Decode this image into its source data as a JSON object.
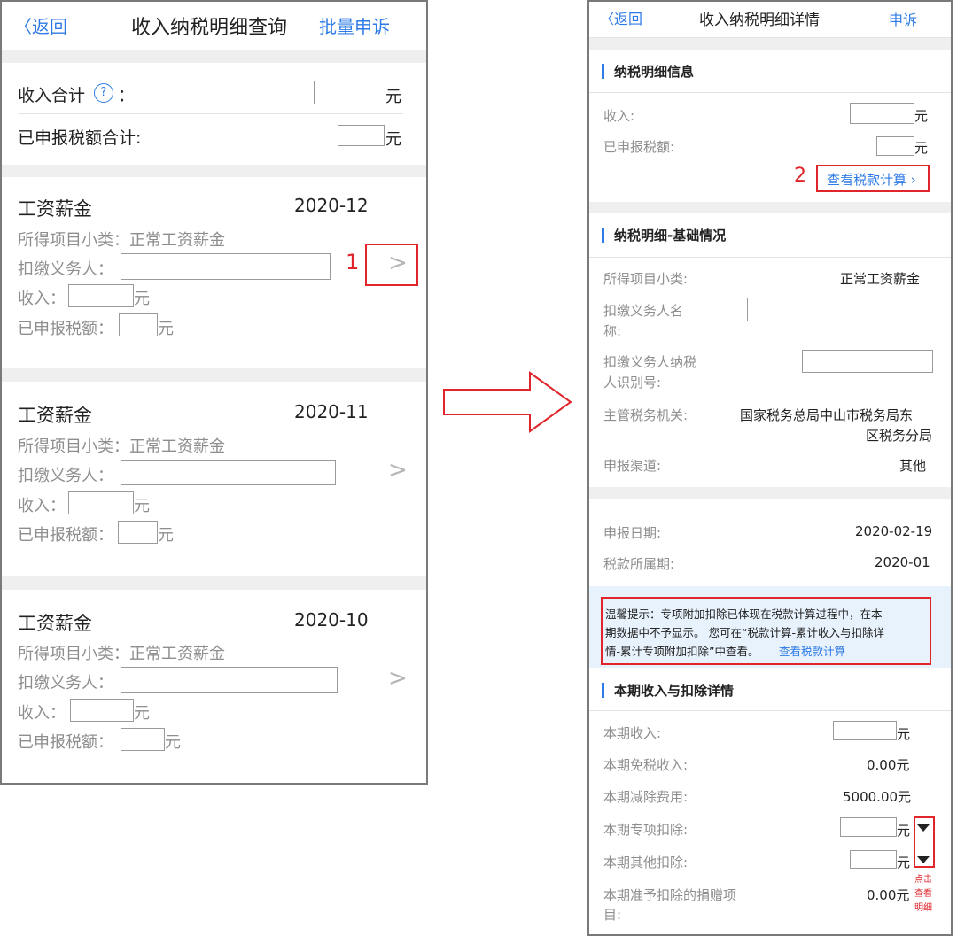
{
  "left": {
    "header": {
      "back": "〈返回",
      "title": "收入纳税明细查询",
      "action": "批量申诉"
    },
    "summary": {
      "income_total_label": "收入合计",
      "help": "?",
      "colon": "：",
      "declared_total_label": "已申报税额合计:",
      "unit": "元"
    },
    "records": [
      {
        "title": "工资薪金",
        "date": "2020-12",
        "subcat": "所得项目小类：正常工资薪金",
        "withholder": "扣缴义务人：",
        "income": "收入：",
        "tax": "已申报税额：",
        "unit": "元"
      },
      {
        "title": "工资薪金",
        "date": "2020-11",
        "subcat": "所得项目小类：正常工资薪金",
        "withholder": "扣缴义务人：",
        "income": "收入：",
        "tax": "已申报税额：",
        "unit": "元"
      },
      {
        "title": "工资薪金",
        "date": "2020-10",
        "subcat": "所得项目小类：正常工资薪金",
        "withholder": "扣缴义务人：",
        "income": "收入：",
        "tax": "已申报税额：",
        "unit": "元"
      }
    ],
    "marker": "1"
  },
  "right": {
    "header": {
      "back": "〈返回",
      "title": "收入纳税明细详情",
      "action": "申诉"
    },
    "sec1": {
      "title": "纳税明细信息",
      "income": "收入:",
      "tax": "已申报税额:",
      "unit": "元",
      "link": "查看税款计算",
      "marker": "2"
    },
    "sec2": {
      "title": "纳税明细-基础情况",
      "subcat_label": "所得项目小类:",
      "subcat_value": "正常工资薪金",
      "withholder_l1": "扣缴义务人名",
      "withholder_l2": "称:",
      "taxid_l1": "扣缴义务人纳税",
      "taxid_l2": "人识别号:",
      "authority_label": "主管税务机关:",
      "authority_l1": "国家税务总局中山市税务局东",
      "authority_l2": "区税务分局",
      "channel_label": "申报渠道:",
      "channel_value": "其他"
    },
    "sec3": {
      "date_label": "申报日期:",
      "date_value": "2020-02-19",
      "period_label": "税款所属期:",
      "period_value": "2020-01"
    },
    "notice": {
      "l1": "温馨提示：专项附加扣除已体现在税款计算过程中，在本",
      "l2": "期数据中不予显示。 您可在“税款计算-累计收入与扣除详",
      "l3": "情-累计专项附加扣除”中查看。",
      "link": "查看税款计算"
    },
    "sec4": {
      "title": "本期收入与扣除详情",
      "income": "本期收入:",
      "exempt": "本期免税收入:",
      "exempt_value": "0.00元",
      "deduct": "本期减除费用:",
      "deduct_value": "5000.00元",
      "special": "本期专项扣除:",
      "other": "本期其他扣除:",
      "donate_l1": "本期准予扣除的捐赠项",
      "donate_l2": "目:",
      "donate_value": "0.00元",
      "unit": "元"
    },
    "hint": {
      "l1": "点击",
      "l2": "查看",
      "l3": "明细"
    }
  }
}
